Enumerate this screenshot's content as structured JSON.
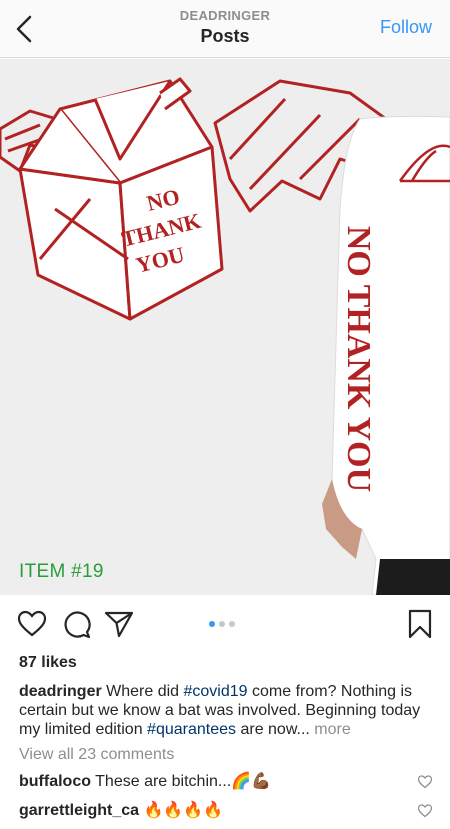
{
  "header": {
    "account": "DEADRINGER",
    "title": "Posts",
    "follow_label": "Follow"
  },
  "post": {
    "box_text": [
      "NO",
      "THANK",
      "YOU"
    ],
    "sleeve_text": "NO THANK YOU",
    "item_label": "ITEM #19",
    "carousel_count": 3,
    "carousel_active": 1,
    "likes": "87 likes",
    "caption": {
      "username": "deadringer",
      "part1": " Where did ",
      "tag1": "#covid19",
      "part2": " come from? Nothing is certain but we know a bat was involved. Beginning today my limited edition ",
      "tag2": "#quarantees",
      "part3": " are now... ",
      "more": "more"
    },
    "view_all": "View all 23 comments",
    "comments": [
      {
        "username": "buffaloco",
        "text": " These are bitchin...🌈💪🏾"
      },
      {
        "username": "garrettleight_ca",
        "text": " 🔥🔥🔥🔥"
      }
    ]
  },
  "colors": {
    "accent": "#3897f0",
    "item_label": "#2a9d3a",
    "illustration_red": "#b22222"
  }
}
